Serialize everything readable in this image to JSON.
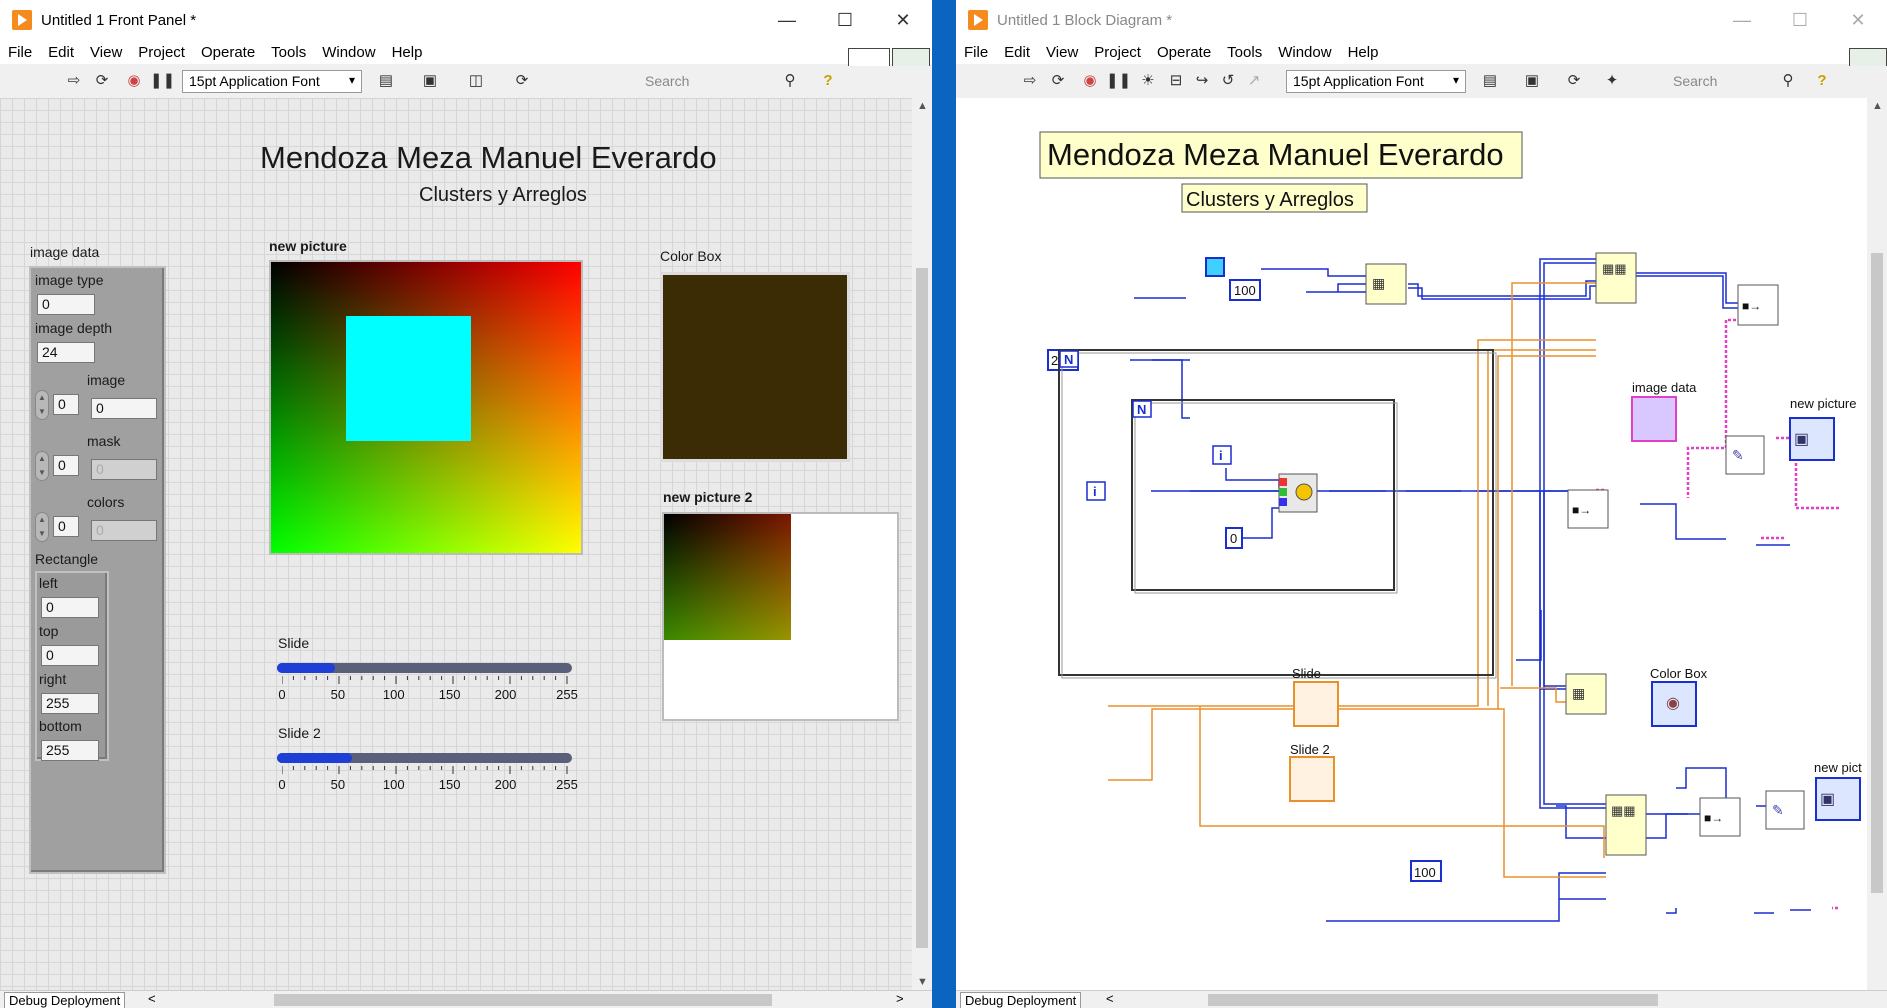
{
  "front_panel": {
    "window_title": "Untitled 1 Front Panel *",
    "menu": [
      "File",
      "Edit",
      "View",
      "Project",
      "Operate",
      "Tools",
      "Window",
      "Help"
    ],
    "font_selector": "15pt Application Font",
    "search_placeholder": "Search",
    "title": "Mendoza Meza Manuel Everardo",
    "subtitle": "Clusters y Arreglos",
    "image_data": {
      "label": "image data",
      "image_type_label": "image type",
      "image_type_value": "0",
      "image_depth_label": "image depth",
      "image_depth_value": "24",
      "image_label": "image",
      "image_index": "0",
      "image_value": "0",
      "mask_label": "mask",
      "mask_index": "0",
      "mask_value": "0",
      "colors_label": "colors",
      "colors_index": "0",
      "colors_value": "0",
      "rectangle_label": "Rectangle",
      "left_label": "left",
      "left_value": "0",
      "top_label": "top",
      "top_value": "0",
      "right_label": "right",
      "right_value": "255",
      "bottom_label": "bottom",
      "bottom_value": "255"
    },
    "new_picture_label": "new picture",
    "color_box_label": "Color Box",
    "color_box_color": "#3c2c06",
    "new_picture2_label": "new picture 2",
    "slide": {
      "label": "Slide",
      "value": 50,
      "max": 255,
      "ticks": [
        "0",
        "50",
        "100",
        "150",
        "200",
        "255"
      ]
    },
    "slide2": {
      "label": "Slide 2",
      "value": 65,
      "max": 255,
      "ticks": [
        "0",
        "50",
        "100",
        "150",
        "200",
        "255"
      ]
    },
    "status_tag": "Debug Deployment"
  },
  "block_diagram": {
    "window_title": "Untitled 1 Block Diagram *",
    "menu": [
      "File",
      "Edit",
      "View",
      "Project",
      "Operate",
      "Tools",
      "Window",
      "Help"
    ],
    "font_selector": "15pt Application Font",
    "search_placeholder": "Search",
    "title": "Mendoza Meza Manuel Everardo",
    "subtitle": "Clusters y Arreglos",
    "const_255": "255",
    "const_100_top": "100",
    "const_100_bottom": "100",
    "const_0": "0",
    "loop_n_outer": "N",
    "loop_n_inner": "N",
    "loop_i_outer": "i",
    "loop_i_inner": "i",
    "label_image_data": "image data",
    "label_new_picture": "new picture",
    "label_slide": "Slide",
    "label_slide2": "Slide 2",
    "label_color_box": "Color Box",
    "label_new_picture2": "new pict",
    "status_tag": "Debug Deployment"
  },
  "colors": {
    "labview_orange": "#f58a1f",
    "wire_blue": "#1a2fd0",
    "wire_orange": "#e8902c",
    "wire_pink": "#e040c8",
    "rect_cyan": "#00ffff"
  }
}
